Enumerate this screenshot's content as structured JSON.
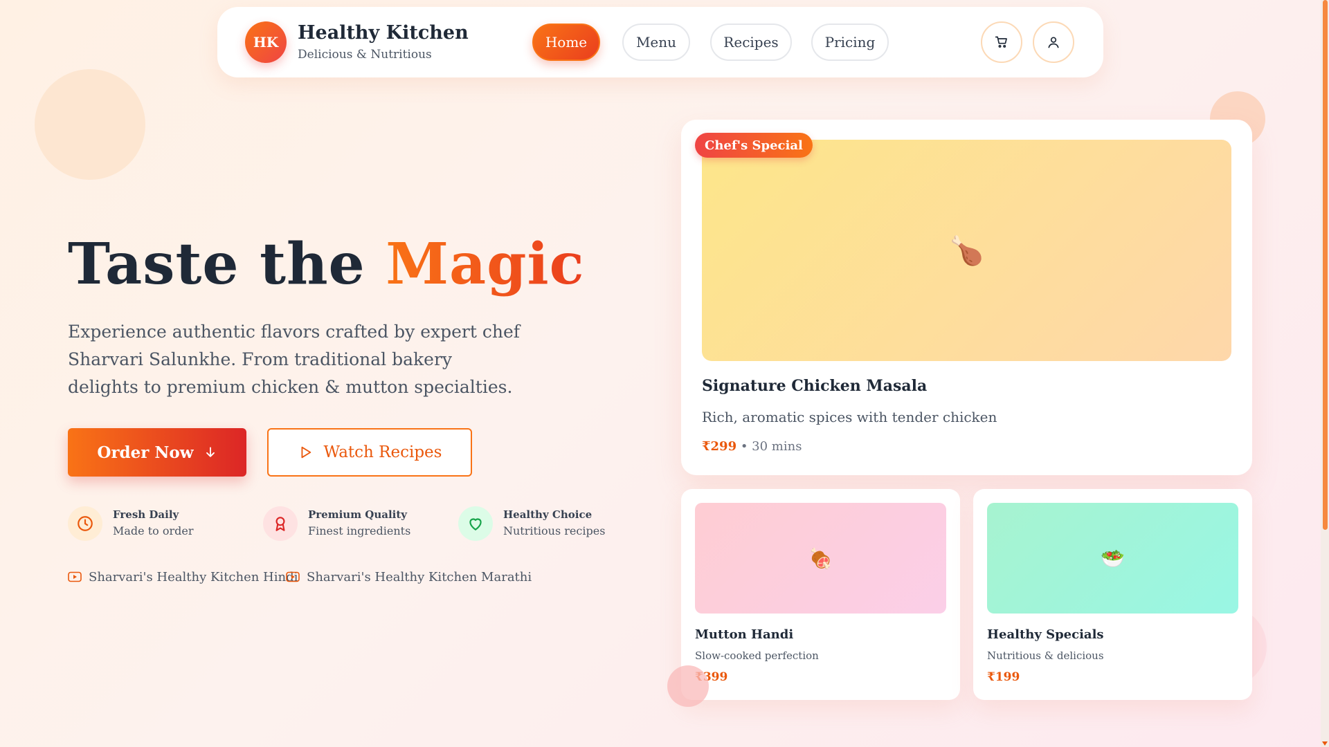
{
  "header": {
    "logo_initials": "HK",
    "brand_title": "Healthy Kitchen",
    "brand_subtitle": "Delicious & Nutritious",
    "nav": [
      {
        "label": "Home",
        "active": true
      },
      {
        "label": "Menu",
        "active": false
      },
      {
        "label": "Recipes",
        "active": false
      },
      {
        "label": "Pricing",
        "active": false
      }
    ],
    "icons": [
      "cart-icon",
      "user-icon"
    ]
  },
  "hero": {
    "title_main": "Taste the ",
    "title_accent": "Magic",
    "description": "Experience authentic flavors crafted by expert chef Sharvari Salunkhe. From traditional bakery delights to premium chicken & mutton specialties.",
    "order_button": "Order Now",
    "watch_button": "Watch Recipes",
    "features": [
      {
        "title": "Fresh Daily",
        "subtitle": "Made to order",
        "icon": "clock-icon"
      },
      {
        "title": "Premium Quality",
        "subtitle": "Finest ingredients",
        "icon": "award-icon"
      },
      {
        "title": "Healthy Choice",
        "subtitle": "Nutritious recipes",
        "icon": "heart-icon"
      }
    ],
    "channels": [
      {
        "label": "Sharvari's Healthy Kitchen Hindi",
        "icon": "youtube-icon"
      },
      {
        "label": "Sharvari's Healthy Kitchen Marathi",
        "icon": "youtube-icon"
      }
    ]
  },
  "featured": {
    "badge": "Chef's Special",
    "emoji": "🍗",
    "title": "Signature Chicken Masala",
    "description": "Rich, aromatic spices with tender chicken",
    "price": "₹299",
    "meta": " • 30 mins"
  },
  "cards": [
    {
      "emoji": "🍖",
      "title": "Mutton Handi",
      "description": "Slow-cooked perfection",
      "price": "₹399"
    },
    {
      "emoji": "🥗",
      "title": "Healthy Specials",
      "description": "Nutritious & delicious",
      "price": "₹199"
    }
  ],
  "colors": {
    "accent": "#f97316",
    "accent_dark": "#dc2626",
    "text": "#1f2937"
  }
}
